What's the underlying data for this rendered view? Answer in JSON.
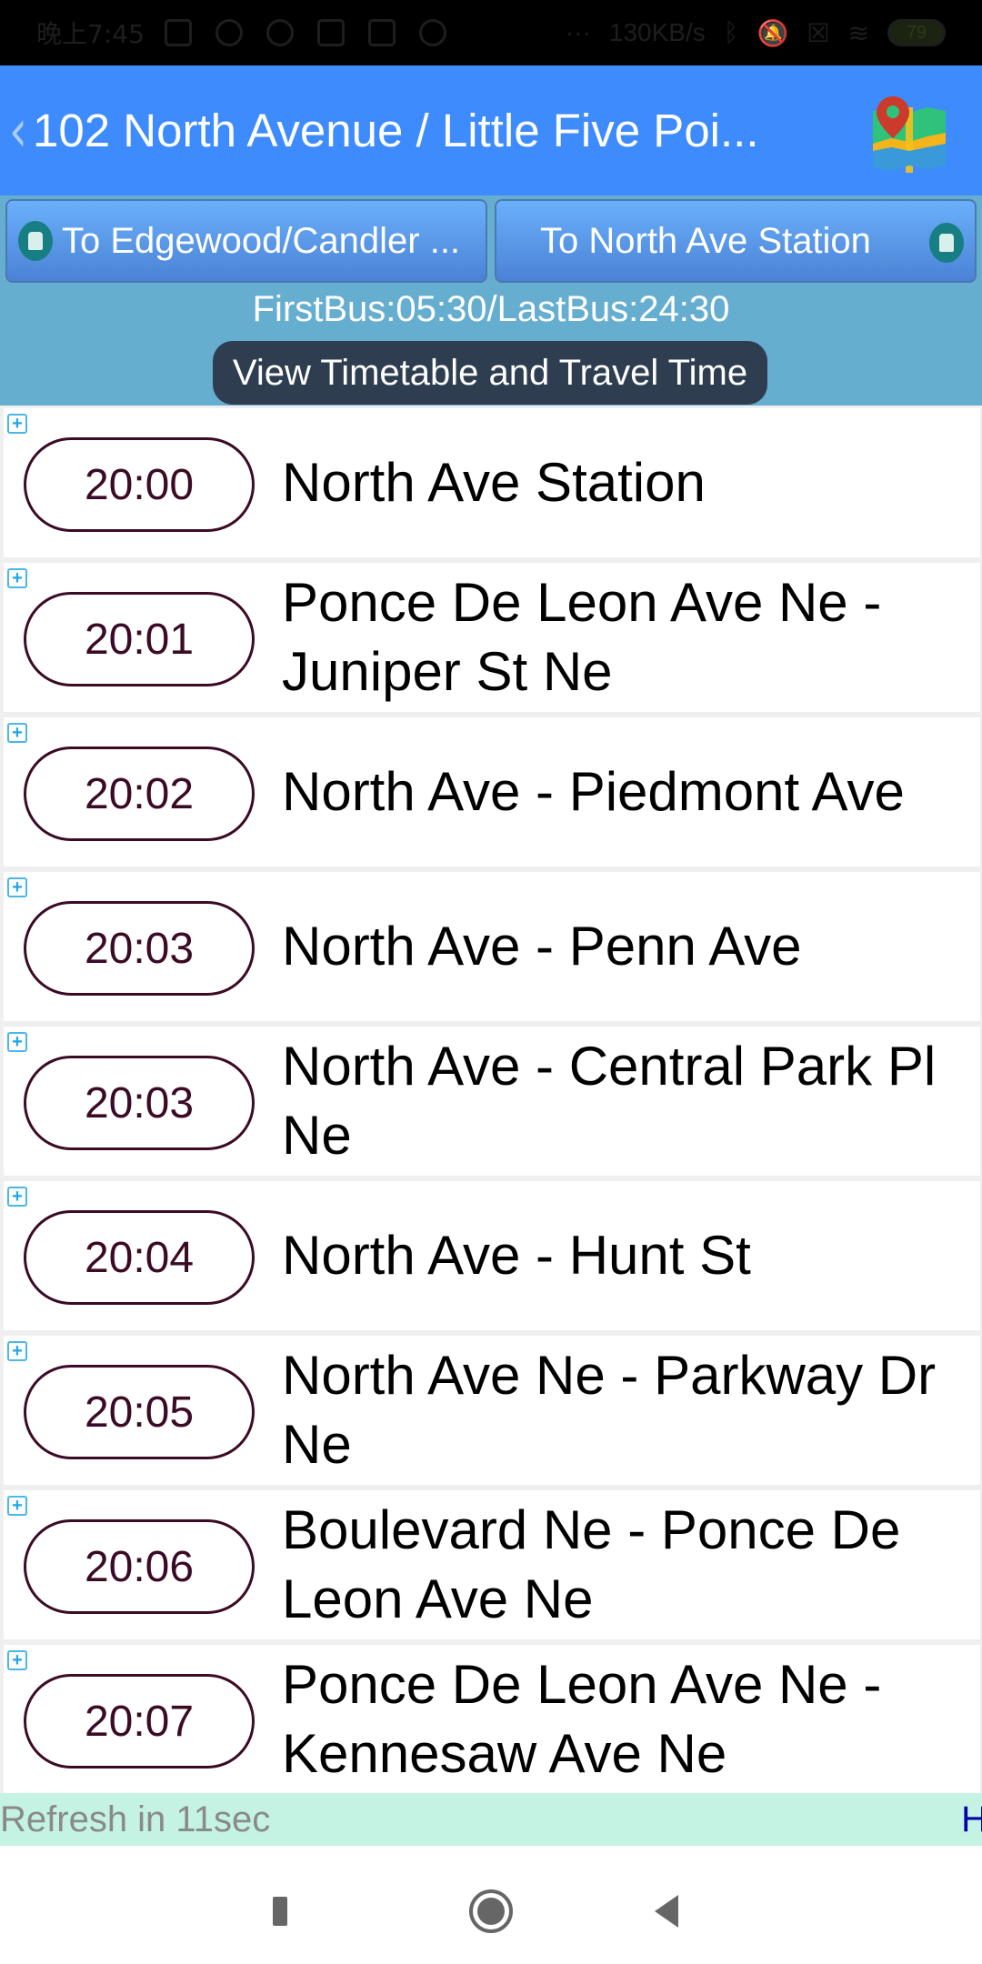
{
  "status_bar": {
    "time": "晚上7:45",
    "network_speed": "130KB/s",
    "battery": "79"
  },
  "header": {
    "back_icon": "chevron-left-icon",
    "title": "102 North Avenue / Little Five Poi...",
    "map_icon": "map-icon"
  },
  "directions": [
    {
      "label": "To Edgewood/Candler ...",
      "icon": "bus-icon"
    },
    {
      "label": "To North Ave Station",
      "icon": "bus-icon"
    }
  ],
  "bus_hours": "FirstBus:05:30/LastBus:24:30",
  "timetable_button": "View Timetable and Travel Time",
  "stops": [
    {
      "time": "20:00",
      "name": "North Ave Station"
    },
    {
      "time": "20:01",
      "name": "Ponce De Leon Ave Ne - Juniper St Ne"
    },
    {
      "time": "20:02",
      "name": "North Ave - Piedmont Ave"
    },
    {
      "time": "20:03",
      "name": "North Ave - Penn Ave"
    },
    {
      "time": "20:03",
      "name": "North Ave - Central Park Pl Ne"
    },
    {
      "time": "20:04",
      "name": "North Ave - Hunt St"
    },
    {
      "time": "20:05",
      "name": "North Ave Ne - Parkway Dr Ne"
    },
    {
      "time": "20:06",
      "name": "Boulevard Ne - Ponce De Leon Ave Ne"
    },
    {
      "time": "20:07",
      "name": "Ponce De Leon Ave Ne - Kennesaw Ave Ne"
    }
  ],
  "footer": {
    "refresh_text": "Refresh in 11sec",
    "link_text": "H"
  },
  "colors": {
    "header_bg": "#3d8bfc",
    "panel_bg": "#66aed0",
    "timetable_btn_bg": "#2e3e50",
    "time_pill": "#3b0b25",
    "refresh_bg": "#c4f3e4"
  }
}
